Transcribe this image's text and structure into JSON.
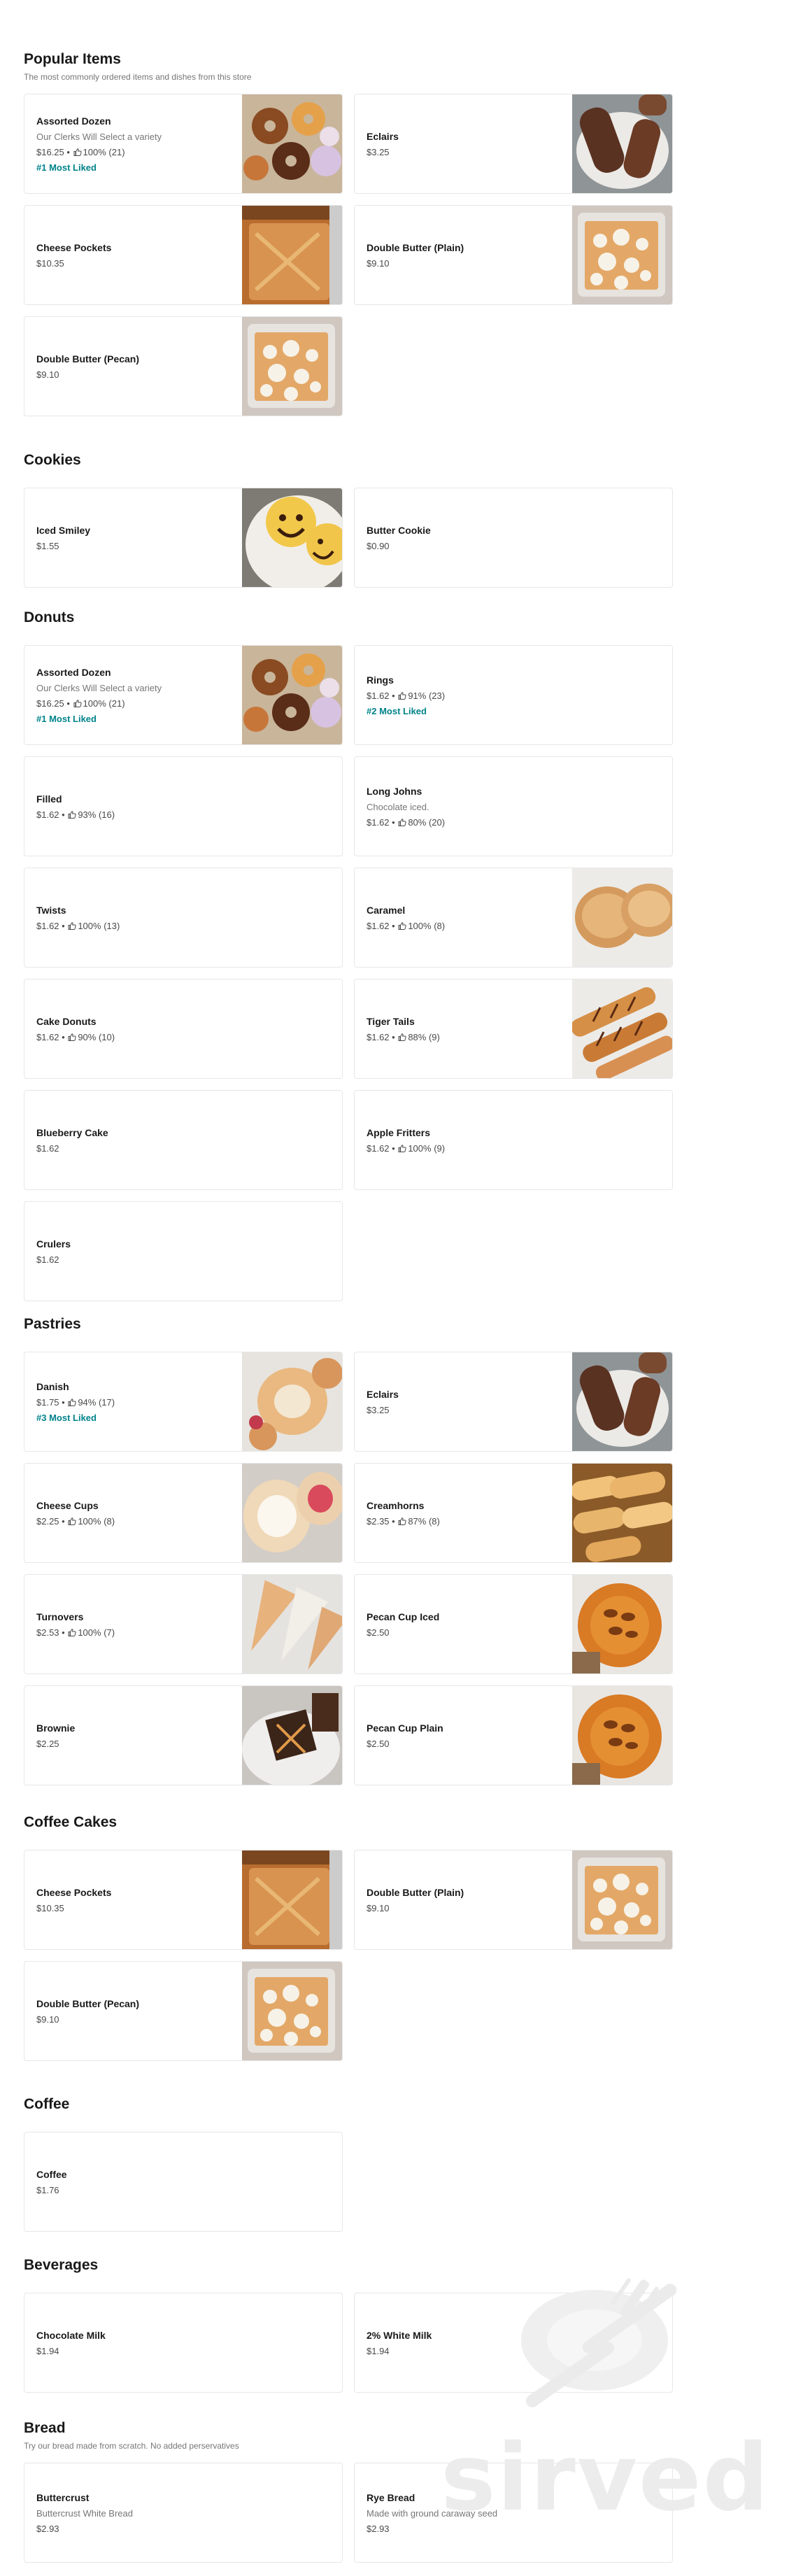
{
  "sections": [
    {
      "id": "popular",
      "title": "Popular Items",
      "subtitle": "The most commonly ordered items and dishes from this store",
      "items": [
        {
          "name": "Assorted Dozen",
          "desc": "Our Clerks Will Select a variety",
          "price": "$16.25",
          "rating": "100% (21)",
          "badge": "#1 Most Liked",
          "image": "assorted-donuts"
        },
        {
          "name": "Eclairs",
          "price": "$3.25",
          "image": "eclairs"
        },
        {
          "name": "Cheese Pockets",
          "price": "$10.35",
          "image": "cheese-pockets"
        },
        {
          "name": "Double Butter (Plain)",
          "price": "$9.10",
          "image": "double-butter"
        },
        {
          "name": "Double Butter (Pecan)",
          "price": "$9.10",
          "image": "double-butter"
        }
      ]
    },
    {
      "id": "cookies",
      "title": "Cookies",
      "items": [
        {
          "name": "Iced Smiley",
          "price": "$1.55",
          "image": "smiley-cookies"
        },
        {
          "name": "Butter Cookie",
          "price": "$0.90"
        }
      ]
    },
    {
      "id": "donuts",
      "title": "Donuts",
      "items": [
        {
          "name": "Assorted Dozen",
          "desc": "Our Clerks Will Select a variety",
          "price": "$16.25",
          "rating": "100% (21)",
          "badge": "#1 Most Liked",
          "image": "assorted-donuts"
        },
        {
          "name": "Rings",
          "price": "$1.62",
          "rating": "91% (23)",
          "badge": "#2 Most Liked"
        },
        {
          "name": "Filled",
          "price": "$1.62",
          "rating": "93% (16)"
        },
        {
          "name": "Long Johns",
          "desc": "Chocolate iced.",
          "price": "$1.62",
          "rating": "80% (20)"
        },
        {
          "name": "Twists",
          "price": "$1.62",
          "rating": "100% (13)"
        },
        {
          "name": "Caramel",
          "price": "$1.62",
          "rating": "100% (8)",
          "image": "caramel"
        },
        {
          "name": "Cake Donuts",
          "price": "$1.62",
          "rating": "90% (10)"
        },
        {
          "name": "Tiger Tails",
          "price": "$1.62",
          "rating": "88% (9)",
          "image": "tiger-tails"
        },
        {
          "name": "Blueberry Cake",
          "price": "$1.62"
        },
        {
          "name": "Apple Fritters",
          "price": "$1.62",
          "rating": "100% (9)"
        },
        {
          "name": "Crulers",
          "price": "$1.62"
        }
      ]
    },
    {
      "id": "pastries",
      "title": "Pastries",
      "items": [
        {
          "name": "Danish",
          "price": "$1.75",
          "rating": "94% (17)",
          "badge": "#3 Most Liked",
          "image": "danish"
        },
        {
          "name": "Eclairs",
          "price": "$3.25",
          "image": "eclairs"
        },
        {
          "name": "Cheese Cups",
          "price": "$2.25",
          "rating": "100% (8)",
          "image": "cheese-cups"
        },
        {
          "name": "Creamhorns",
          "price": "$2.35",
          "rating": "87% (8)",
          "image": "creamhorns"
        },
        {
          "name": "Turnovers",
          "price": "$2.53",
          "rating": "100% (7)",
          "image": "turnovers"
        },
        {
          "name": "Pecan Cup Iced",
          "price": "$2.50",
          "image": "pecan-cup"
        },
        {
          "name": "Brownie",
          "price": "$2.25",
          "image": "brownie"
        },
        {
          "name": "Pecan Cup Plain",
          "price": "$2.50",
          "image": "pecan-cup"
        }
      ]
    },
    {
      "id": "coffee-cakes",
      "title": "Coffee Cakes",
      "items": [
        {
          "name": "Cheese Pockets",
          "price": "$10.35",
          "image": "cheese-pockets"
        },
        {
          "name": "Double Butter (Plain)",
          "price": "$9.10",
          "image": "double-butter"
        },
        {
          "name": "Double Butter (Pecan)",
          "price": "$9.10",
          "image": "double-butter"
        }
      ]
    },
    {
      "id": "coffee",
      "title": "Coffee",
      "items": [
        {
          "name": "Coffee",
          "price": "$1.76"
        }
      ]
    },
    {
      "id": "beverages",
      "title": "Beverages",
      "items": [
        {
          "name": "Chocolate Milk",
          "price": "$1.94"
        },
        {
          "name": "2% White Milk",
          "price": "$1.94"
        }
      ]
    },
    {
      "id": "bread",
      "title": "Bread",
      "subtitle": "Try our bread made from scratch. No added perservatives",
      "items": [
        {
          "name": "Buttercrust",
          "desc": "Buttercrust White Bread",
          "price": "$2.93"
        },
        {
          "name": "Rye Bread",
          "desc": "Made with ground caraway seed",
          "price": "$2.93"
        }
      ]
    }
  ],
  "watermark": {
    "text": "sirved"
  },
  "colors": {
    "accent": "#00838a",
    "border": "#e7e7e7",
    "muted": "#767676"
  }
}
